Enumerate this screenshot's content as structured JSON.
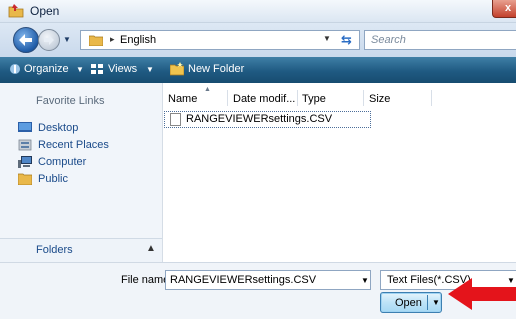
{
  "window": {
    "title": "Open",
    "close_label": "x"
  },
  "address": {
    "sep": "▸",
    "folder": "English",
    "search_placeholder": "Search"
  },
  "toolbar": {
    "organize": "Organize",
    "views": "Views",
    "new_folder": "New Folder"
  },
  "favorites": {
    "heading": "Favorite Links",
    "items": [
      {
        "label": "Desktop",
        "icon": "desktop-icon"
      },
      {
        "label": "Recent Places",
        "icon": "recent-places-icon"
      },
      {
        "label": "Computer",
        "icon": "computer-icon"
      },
      {
        "label": "Public",
        "icon": "folder-icon"
      }
    ],
    "folders_label": "Folders"
  },
  "columns": [
    "Name",
    "Date modif...",
    "Type",
    "Size"
  ],
  "files": [
    {
      "name": "RANGEVIEWERsettings.CSV"
    }
  ],
  "bottom": {
    "file_name_label": "File name:",
    "file_name_value": "RANGEVIEWERsettings.CSV",
    "file_type_value": "Text Files(*.CSV)",
    "open_label": "Open"
  },
  "colors": {
    "toolbar": "#1f5a82",
    "accent": "#1b4b8a",
    "arrow": "#e4141b"
  }
}
